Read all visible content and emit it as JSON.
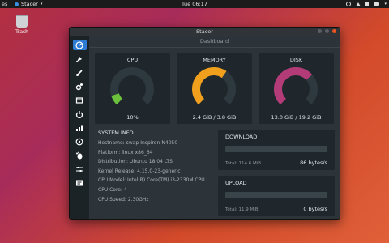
{
  "topbar": {
    "activities": "es",
    "app_name": "Stacer",
    "clock": "Tue 06:17"
  },
  "desktop": {
    "trash_label": "Trash"
  },
  "window": {
    "title": "Stacer"
  },
  "sidebar": {
    "items": [
      {
        "icon": "dashboard-icon",
        "active": true
      },
      {
        "icon": "rocket-icon"
      },
      {
        "icon": "brush-icon"
      },
      {
        "icon": "gears-icon"
      },
      {
        "icon": "package-icon"
      },
      {
        "icon": "power-icon"
      },
      {
        "icon": "bar-chart-icon"
      },
      {
        "icon": "apt-repository-icon"
      },
      {
        "icon": "gnome-foot-icon"
      },
      {
        "icon": "sliders-icon"
      },
      {
        "icon": "terminal-icon"
      }
    ]
  },
  "dashboard": {
    "title": "Dashboard",
    "gauges": [
      {
        "title": "CPU",
        "value": "10%",
        "percent": 10,
        "color": "#6bc13b"
      },
      {
        "title": "MEMORY",
        "value": "2.4 GiB / 3.8 GiB",
        "percent": 63,
        "color": "#f0a01c"
      },
      {
        "title": "DISK",
        "value": "13.0 GiB / 19.2 GiB",
        "percent": 68,
        "color": "#b23b78"
      }
    ],
    "system_info": {
      "title": "SYSTEM INFO",
      "lines": [
        "Hostname: swap-Inspiron-N4050",
        "Platform: linux x86_64",
        "Distribution: Ubuntu 18.04 LTS",
        "Kernel Release: 4.15.0-23-generic",
        "CPU Model: Intel(R) Core(TM) i3-2330M CPU",
        "CPU Core: 4",
        "CPU Speed: 2.30GHz"
      ]
    },
    "download": {
      "title": "DOWNLOAD",
      "total": "Total: 114.6 MiB",
      "rate": "86 bytes/s",
      "fill_percent": 0
    },
    "upload": {
      "title": "UPLOAD",
      "total": "Total: 11.9 MiB",
      "rate": "0 bytes/s",
      "fill_percent": 0
    },
    "gauge_track_color": "#2e393f"
  }
}
